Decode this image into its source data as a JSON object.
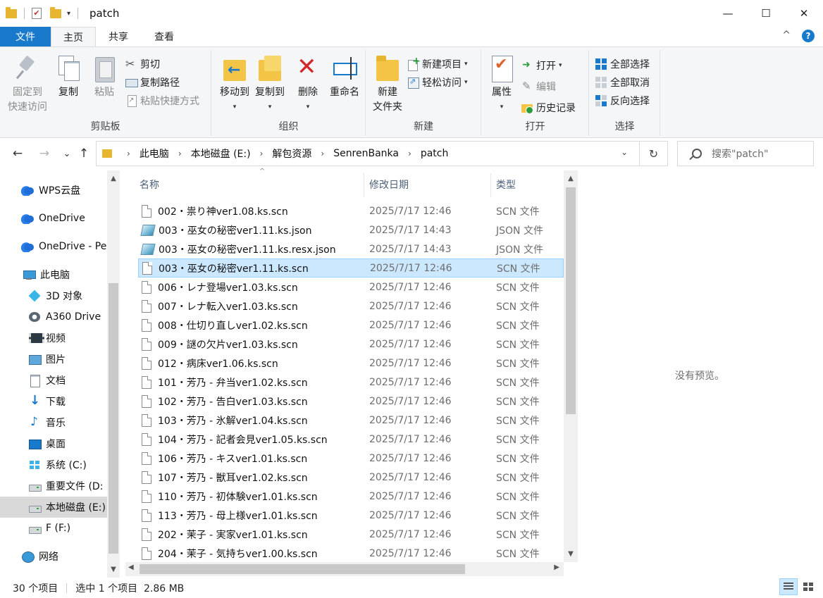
{
  "window": {
    "title": "patch",
    "minimize_glyph": "—",
    "maximize_glyph": "☐",
    "close_glyph": "✕"
  },
  "ribbon_tabs": {
    "file": "文件",
    "home": "主页",
    "share": "共享",
    "view": "查看",
    "collapse_glyph": "^",
    "help_glyph": "?"
  },
  "ribbon": {
    "clipboard": {
      "label": "剪贴板",
      "pin_line1": "固定到",
      "pin_line2": "快速访问",
      "copy": "复制",
      "paste": "粘贴",
      "cut": "剪切",
      "copy_path": "复制路径",
      "paste_shortcut": "粘贴快捷方式"
    },
    "organize": {
      "label": "组织",
      "move_to": "移动到",
      "copy_to": "复制到",
      "delete": "删除",
      "rename": "重命名"
    },
    "new": {
      "label": "新建",
      "new_folder_line1": "新建",
      "new_folder_line2": "文件夹",
      "new_item": "新建项目",
      "easy_access": "轻松访问"
    },
    "open": {
      "label": "打开",
      "properties": "属性",
      "open": "打开",
      "edit": "编辑",
      "history": "历史记录"
    },
    "select": {
      "label": "选择",
      "select_all": "全部选择",
      "select_none": "全部取消",
      "invert": "反向选择"
    }
  },
  "address": {
    "back_glyph": "←",
    "forward_glyph": "→",
    "recent_glyph": "⌄",
    "up_glyph": "↑",
    "crumbs": [
      "此电脑",
      "本地磁盘 (E:)",
      "解包资源",
      "SenrenBanka",
      "patch"
    ],
    "crumb_sep": "›",
    "dropdown_glyph": "⌄",
    "refresh_glyph": "↻",
    "search_placeholder": "搜索\"patch\""
  },
  "nav_pane": {
    "items": [
      {
        "label": "WPS云盘",
        "icon": "cloud-icon"
      },
      {
        "label": "OneDrive",
        "icon": "onedrive-icon"
      },
      {
        "label": "OneDrive - Pe",
        "icon": "onedrive-icon"
      },
      {
        "label": "此电脑",
        "icon": "computer-icon"
      },
      {
        "label": "3D 对象",
        "icon": "3d-objects-icon"
      },
      {
        "label": "A360 Drive",
        "icon": "a360-drive-icon"
      },
      {
        "label": "视频",
        "icon": "video-icon"
      },
      {
        "label": "图片",
        "icon": "picture-icon"
      },
      {
        "label": "文档",
        "icon": "document-icon"
      },
      {
        "label": "下载",
        "icon": "download-icon"
      },
      {
        "label": "音乐",
        "icon": "music-icon"
      },
      {
        "label": "桌面",
        "icon": "desktop-icon"
      },
      {
        "label": "系统 (C:)",
        "icon": "windows-drive-icon"
      },
      {
        "label": "重要文件 (D:",
        "icon": "drive-icon"
      },
      {
        "label": "本地磁盘 (E:)",
        "icon": "drive-icon"
      },
      {
        "label": "F (F:)",
        "icon": "drive-icon"
      },
      {
        "label": "网络",
        "icon": "network-icon"
      }
    ],
    "selected_index": 14
  },
  "file_list": {
    "columns": {
      "name": "名称",
      "date": "修改日期",
      "type": "类型"
    },
    "selected_index": 3,
    "files": [
      {
        "name": "002・祟り神ver1.08.ks.scn",
        "date": "2025/7/17 12:46",
        "type": "SCN 文件",
        "icon": "doc"
      },
      {
        "name": "003・巫女の秘密ver1.11.ks.json",
        "date": "2025/7/17 14:43",
        "type": "JSON 文件",
        "icon": "json"
      },
      {
        "name": "003・巫女の秘密ver1.11.ks.resx.json",
        "date": "2025/7/17 14:43",
        "type": "JSON 文件",
        "icon": "json"
      },
      {
        "name": "003・巫女の秘密ver1.11.ks.scn",
        "date": "2025/7/17 12:46",
        "type": "SCN 文件",
        "icon": "doc"
      },
      {
        "name": "006・レナ登場ver1.03.ks.scn",
        "date": "2025/7/17 12:46",
        "type": "SCN 文件",
        "icon": "doc"
      },
      {
        "name": "007・レナ転入ver1.03.ks.scn",
        "date": "2025/7/17 12:46",
        "type": "SCN 文件",
        "icon": "doc"
      },
      {
        "name": "008・仕切り直しver1.02.ks.scn",
        "date": "2025/7/17 12:46",
        "type": "SCN 文件",
        "icon": "doc"
      },
      {
        "name": "009・謎の欠片ver1.03.ks.scn",
        "date": "2025/7/17 12:46",
        "type": "SCN 文件",
        "icon": "doc"
      },
      {
        "name": "012・病床ver1.06.ks.scn",
        "date": "2025/7/17 12:46",
        "type": "SCN 文件",
        "icon": "doc"
      },
      {
        "name": "101・芳乃 - 弁当ver1.02.ks.scn",
        "date": "2025/7/17 12:46",
        "type": "SCN 文件",
        "icon": "doc"
      },
      {
        "name": "102・芳乃 - 告白ver1.03.ks.scn",
        "date": "2025/7/17 12:46",
        "type": "SCN 文件",
        "icon": "doc"
      },
      {
        "name": "103・芳乃 - 氷解ver1.04.ks.scn",
        "date": "2025/7/17 12:46",
        "type": "SCN 文件",
        "icon": "doc"
      },
      {
        "name": "104・芳乃 - 記者会見ver1.05.ks.scn",
        "date": "2025/7/17 12:46",
        "type": "SCN 文件",
        "icon": "doc"
      },
      {
        "name": "106・芳乃 - キスver1.01.ks.scn",
        "date": "2025/7/17 12:46",
        "type": "SCN 文件",
        "icon": "doc"
      },
      {
        "name": "107・芳乃 - 獣耳ver1.02.ks.scn",
        "date": "2025/7/17 12:46",
        "type": "SCN 文件",
        "icon": "doc"
      },
      {
        "name": "110・芳乃 - 初体験ver1.01.ks.scn",
        "date": "2025/7/17 12:46",
        "type": "SCN 文件",
        "icon": "doc"
      },
      {
        "name": "113・芳乃 - 母上様ver1.01.ks.scn",
        "date": "2025/7/17 12:46",
        "type": "SCN 文件",
        "icon": "doc"
      },
      {
        "name": "202・茉子 - 実家ver1.01.ks.scn",
        "date": "2025/7/17 12:46",
        "type": "SCN 文件",
        "icon": "doc"
      },
      {
        "name": "204・茉子 - 気持ちver1.00.ks.scn",
        "date": "2025/7/17 12:46",
        "type": "SCN 文件",
        "icon": "doc"
      }
    ]
  },
  "preview": {
    "text": "没有预览。"
  },
  "status": {
    "item_count": "30 个项目",
    "selection": "选中 1 个项目  2.86 MB"
  }
}
